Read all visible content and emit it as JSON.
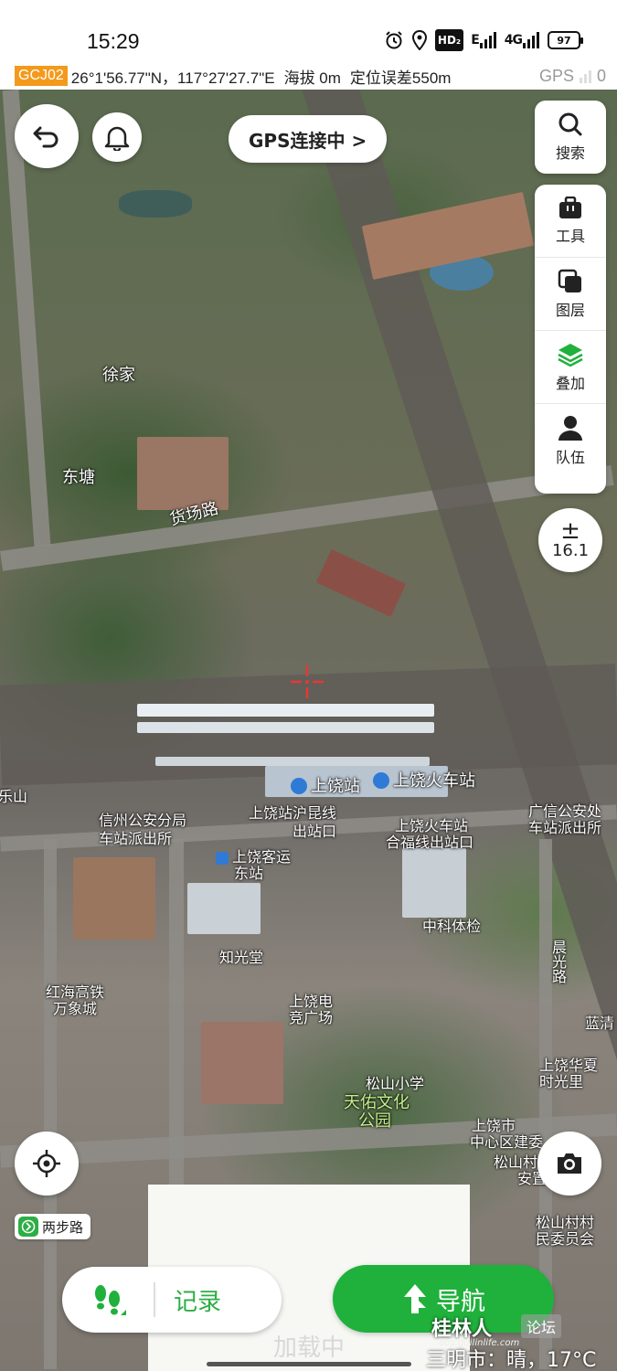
{
  "status_bar": {
    "time": "15:29",
    "network_badge": "HD₂",
    "signal_1": "E",
    "signal_2": "4G",
    "battery": "97"
  },
  "coord_bar": {
    "system": "GCJ02",
    "coordinates": "26°1'56.77\"N，117°27'27.7\"E",
    "altitude": "海拔 0m",
    "accuracy": "定位误差550m",
    "gps_label": "GPS",
    "gps_count": "0"
  },
  "top_controls": {
    "gps_button": "GPS连接中 >"
  },
  "side_panel": {
    "search": "搜索",
    "tools": "工具",
    "layers": "图层",
    "overlay": "叠加",
    "team": "队伍"
  },
  "zoom": {
    "symbol": "±",
    "level": "16.1"
  },
  "map_labels": {
    "xujia": "徐家",
    "dongtang": "东塘",
    "huochang_road": "货场路",
    "shangrao_station": "上饶站",
    "shangrao_train_station": "上饶火车站",
    "hukun_exit": "上饶站沪昆线",
    "hukun_exit_2": "出站口",
    "hefu_exit": "上饶火车站",
    "hefu_exit_2": "合福线出站口",
    "xinzhou_police": "信州公安分局",
    "xinzhou_police_2": "车站派出所",
    "bus_east": "上饶客运",
    "bus_east_2": "东站",
    "guangxin_police": "广信公安处",
    "guangxin_police_2": "车站派出所",
    "zhongke": "中科体检",
    "chenguang_road": "晨光路",
    "zhiguang": "知光堂",
    "wanxiang": "红海高铁",
    "wanxiang_2": "万象城",
    "esports": "上饶电",
    "esports_2": "竞广场",
    "songshan_school": "松山小学",
    "tianyou_park": "天佑文化",
    "tianyou_park_2": "公园",
    "lanqing": "蓝清",
    "center_area": "上饶市",
    "center_area_2": "中心区建委",
    "songshan_village": "松山村村",
    "songshan_village_2": "民委员会",
    "shimao": "上饶华夏",
    "shimao_2": "时光里",
    "songshan_station": "松山村",
    "songshan_station_2": "安置",
    "left_edge": "乐山"
  },
  "bottom": {
    "walk_mode": "两步路",
    "record_label": "记录",
    "navigate_label": "导航",
    "loading": "加载中"
  },
  "watermark": {
    "site": "桂林人",
    "forum": "论坛",
    "url": "bbs.guilinlife.com",
    "weather": "三明市：晴，17°C"
  },
  "colors": {
    "accent_green": "#1fb13b",
    "gcj_orange": "#f39a1c",
    "crosshair_red": "#e53935"
  }
}
